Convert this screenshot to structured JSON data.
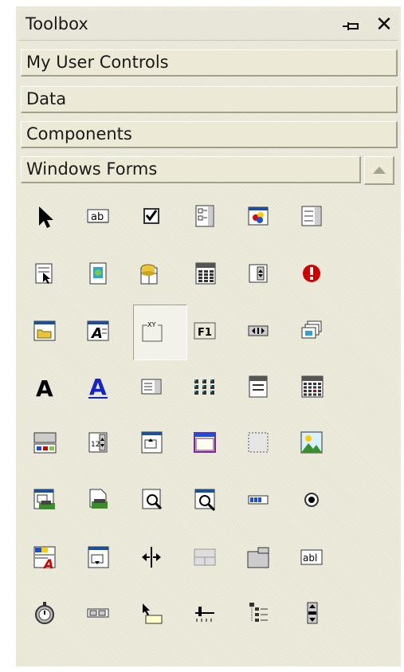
{
  "window": {
    "title": "Toolbox",
    "pin_icon": "pin-icon",
    "close_icon": "close-icon",
    "close_glyph": "✕"
  },
  "tabs": [
    {
      "label": "My User Controls"
    },
    {
      "label": "Data"
    },
    {
      "label": "Components"
    },
    {
      "label": "Windows Forms",
      "expanded": true
    }
  ],
  "scroll": {
    "icon": "scroll-up-icon"
  },
  "tools": [
    {
      "icon": "pointer"
    },
    {
      "icon": "label",
      "text": "ab"
    },
    {
      "icon": "checkbox"
    },
    {
      "icon": "checked-listbox"
    },
    {
      "icon": "color-dialog"
    },
    {
      "icon": "combobox"
    },
    {
      "icon": "context-menu"
    },
    {
      "icon": "crystal-report-viewer"
    },
    {
      "icon": "data-grid"
    },
    {
      "icon": "datetime-picker"
    },
    {
      "icon": "domain-updown"
    },
    {
      "icon": "error-provider"
    },
    {
      "icon": "folder-browser-dialog"
    },
    {
      "icon": "font-dialog",
      "text": "A"
    },
    {
      "icon": "groupbox",
      "text": "XY",
      "selected": true
    },
    {
      "icon": "help-provider",
      "text": "F1"
    },
    {
      "icon": "hscrollbar"
    },
    {
      "icon": "imagelist"
    },
    {
      "icon": "label-text",
      "text": "A"
    },
    {
      "icon": "linklabel",
      "text": "A"
    },
    {
      "icon": "listbox"
    },
    {
      "icon": "listview"
    },
    {
      "icon": "mainmenu"
    },
    {
      "icon": "monthcalendar"
    },
    {
      "icon": "notifyicon"
    },
    {
      "icon": "numeric-updown",
      "text": "12"
    },
    {
      "icon": "open-file-dialog"
    },
    {
      "icon": "panel"
    },
    {
      "icon": "panel-dotted"
    },
    {
      "icon": "picturebox"
    },
    {
      "icon": "page-setup-dialog"
    },
    {
      "icon": "print-dialog"
    },
    {
      "icon": "print-preview-control"
    },
    {
      "icon": "print-preview-dialog"
    },
    {
      "icon": "progressbar"
    },
    {
      "icon": "radiobutton"
    },
    {
      "icon": "richtextbox",
      "text": "A"
    },
    {
      "icon": "save-file-dialog"
    },
    {
      "icon": "splitter"
    },
    {
      "icon": "statusbar"
    },
    {
      "icon": "tabcontrol"
    },
    {
      "icon": "textbox",
      "text": "abl"
    },
    {
      "icon": "timer"
    },
    {
      "icon": "toolbar"
    },
    {
      "icon": "tooltip"
    },
    {
      "icon": "trackbar"
    },
    {
      "icon": "treeview"
    },
    {
      "icon": "vscrollbar"
    }
  ]
}
